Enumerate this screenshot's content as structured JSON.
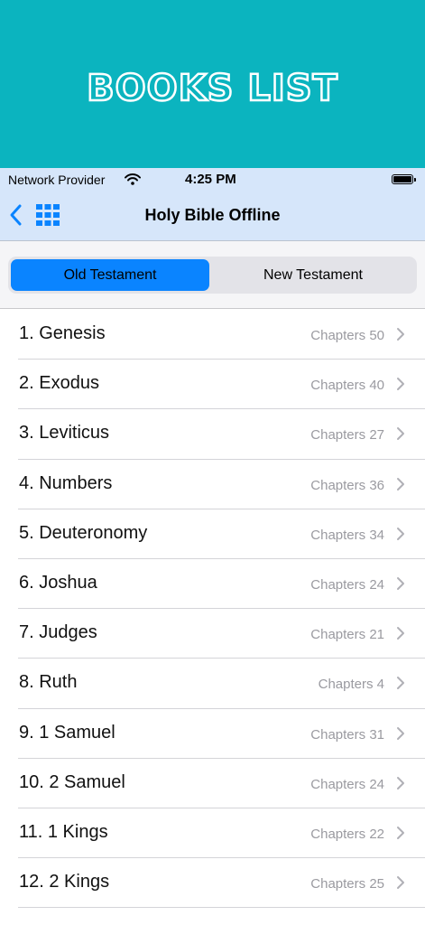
{
  "banner": {
    "title": "BOOKS LIST"
  },
  "status_bar": {
    "carrier": "Network Provider",
    "time": "4:25 PM"
  },
  "nav": {
    "title": "Holy Bible Offline",
    "back_icon": "chevron-left-icon",
    "grid_icon": "grid-icon"
  },
  "segments": {
    "old": "Old Testament",
    "new": "New Testament",
    "selected": "Old Testament"
  },
  "colors": {
    "banner": "#0bb4bf",
    "navbar": "#d6e6fa",
    "accent": "#0a84ff"
  },
  "books": [
    {
      "name": "1. Genesis",
      "chapters": "Chapters 50"
    },
    {
      "name": "2. Exodus",
      "chapters": "Chapters 40"
    },
    {
      "name": "3. Leviticus",
      "chapters": "Chapters 27"
    },
    {
      "name": "4. Numbers",
      "chapters": "Chapters 36"
    },
    {
      "name": "5. Deuteronomy",
      "chapters": "Chapters 34"
    },
    {
      "name": "6. Joshua",
      "chapters": "Chapters 24"
    },
    {
      "name": "7. Judges",
      "chapters": "Chapters 21"
    },
    {
      "name": "8. Ruth",
      "chapters": "Chapters 4"
    },
    {
      "name": "9. 1 Samuel",
      "chapters": "Chapters 31"
    },
    {
      "name": "10. 2 Samuel",
      "chapters": "Chapters 24"
    },
    {
      "name": "11. 1 Kings",
      "chapters": "Chapters 22"
    },
    {
      "name": "12. 2 Kings",
      "chapters": "Chapters 25"
    }
  ]
}
